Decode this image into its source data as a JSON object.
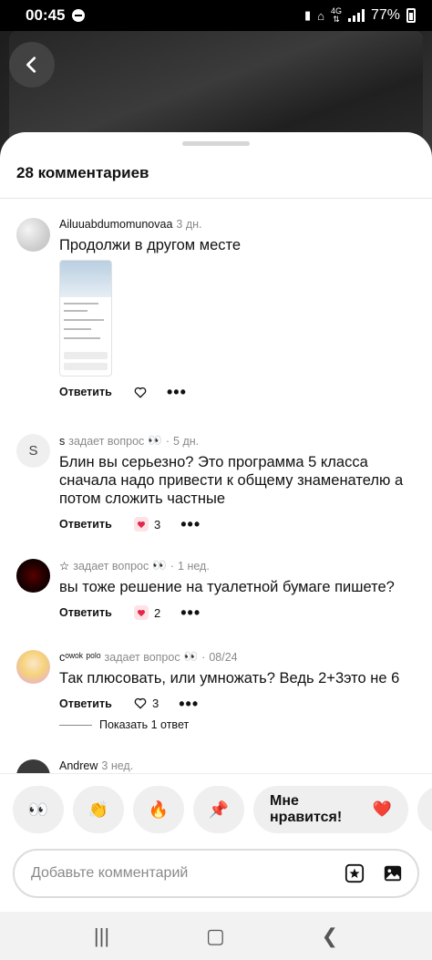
{
  "status_bar": {
    "time": "00:45",
    "network": "4G",
    "battery": "77%"
  },
  "sheet": {
    "title": "28 комментариев"
  },
  "comments": [
    {
      "author": "Ailuuabdumomunovaa",
      "time": "3 дн.",
      "text": "Продолжи в другом месте",
      "reply_label": "Ответить",
      "has_image": true
    },
    {
      "author": "s",
      "avatar_letter": "S",
      "badge": "задает вопрос",
      "badge_emoji": "👀",
      "time": "5 дн.",
      "text": "Блин вы серьезно? Это программа 5 класса сначала надо привести к общему знаменателю а потом сложить частные",
      "reply_label": "Ответить",
      "likes": "3"
    },
    {
      "author": "☆",
      "badge": "задает вопрос",
      "badge_emoji": "👀",
      "time": "1 нед.",
      "text": "вы тоже решение на туалетной бумаге пишете?",
      "reply_label": "Ответить",
      "likes": "2"
    },
    {
      "author": "cᵒʷᵒᵏ ᵖᵒˡᵒ",
      "badge": "задает вопрос",
      "badge_emoji": "👀",
      "time": "08/24",
      "text": "Так плюсовать, или умножать? Ведь 2+3это не 6",
      "reply_label": "Ответить",
      "likes": "3",
      "show_replies": "Показать 1 ответ"
    },
    {
      "author": "Andrew",
      "time": "3 нед."
    }
  ],
  "reactions": [
    "👀",
    "👏",
    "🔥",
    "📌"
  ],
  "like_pill": {
    "label": "Мне нравится!",
    "emoji": "❤️"
  },
  "input": {
    "placeholder": "Добавьте комментарий"
  },
  "colors": {
    "heart_red": "#e5264a",
    "sheet_bg": "#ffffff",
    "pill_bg": "#efefef"
  }
}
